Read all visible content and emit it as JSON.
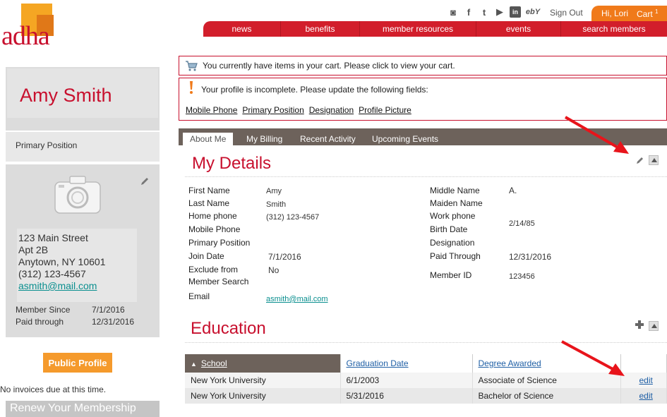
{
  "brand": {
    "logo_text": "adha",
    "accent": "#c8102e",
    "orange": "#f07a1a"
  },
  "header": {
    "social_icons": [
      "instagram-icon",
      "facebook-icon",
      "twitter-icon",
      "youtube-icon",
      "linkedin-icon",
      "ebay-icon"
    ],
    "social_glyphs": {
      "instagram": "◙",
      "facebook": "f",
      "twitter": "t",
      "youtube": "▶",
      "linkedin": "in",
      "ebay": "ebY"
    },
    "sign_out": "Sign Out",
    "greeting": "Hi, Lori",
    "cart_label": "Cart",
    "cart_count": "1"
  },
  "nav": {
    "items": [
      "news",
      "benefits",
      "member resources",
      "events",
      "search members"
    ]
  },
  "sidebar": {
    "name": "Amy Smith",
    "primary_position_label": "Primary Position",
    "address": {
      "street": "123 Main Street",
      "apt": "Apt 2B",
      "city": "Anytown, NY 10601",
      "phone": "(312) 123-4567",
      "email": "asmith@mail.com"
    },
    "member_since_label": "Member Since",
    "member_since": "7/1/2016",
    "paid_through_label": "Paid through",
    "paid_through": "12/31/2016",
    "public_profile_button": "Public Profile",
    "no_invoices": "No invoices due at this time.",
    "renew_button": "Renew Your Membership"
  },
  "messages": {
    "cart": "You currently have items in your cart. Please click to view your cart.",
    "profile_incomplete": "Your profile is incomplete. Please update the following fields:",
    "missing_fields": [
      "Mobile Phone",
      "Primary Position",
      "Designation",
      "Profile Picture"
    ]
  },
  "tabs": [
    "About Me",
    "My Billing",
    "Recent Activity",
    "Upcoming Events"
  ],
  "details": {
    "title": "My Details",
    "left": {
      "first_name_label": "First Name",
      "first_name": "Amy",
      "last_name_label": "Last Name",
      "last_name": "Smith",
      "home_phone_label": "Home phone",
      "home_phone": "(312) 123-4567",
      "mobile_phone_label": "Mobile Phone",
      "primary_position_label": "Primary Position",
      "join_date_label": "Join Date",
      "join_date": "7/1/2016",
      "exclude_label_1": "Exclude from",
      "exclude_label_2": "Member Search",
      "exclude": "No",
      "email_label": "Email",
      "email": "asmith@mail.com"
    },
    "right": {
      "middle_name_label": "Middle Name",
      "middle_name": "A.",
      "maiden_name_label": "Maiden Name",
      "work_phone_label": "Work phone",
      "birth_date_label": "Birth Date",
      "birth_date": "2/14/85",
      "designation_label": "Designation",
      "paid_through_label": "Paid Through",
      "paid_through": "12/31/2016",
      "member_id_label": "Member ID",
      "member_id": "123456"
    }
  },
  "education": {
    "title": "Education",
    "columns": [
      "School",
      "Graduation Date",
      "Degree Awarded"
    ],
    "rows": [
      {
        "school": "New York University",
        "date": "6/1/2003",
        "degree": "Associate of Science",
        "action": "edit"
      },
      {
        "school": "New York University",
        "date": "5/31/2016",
        "degree": "Bachelor of Science",
        "action": "edit"
      }
    ]
  }
}
